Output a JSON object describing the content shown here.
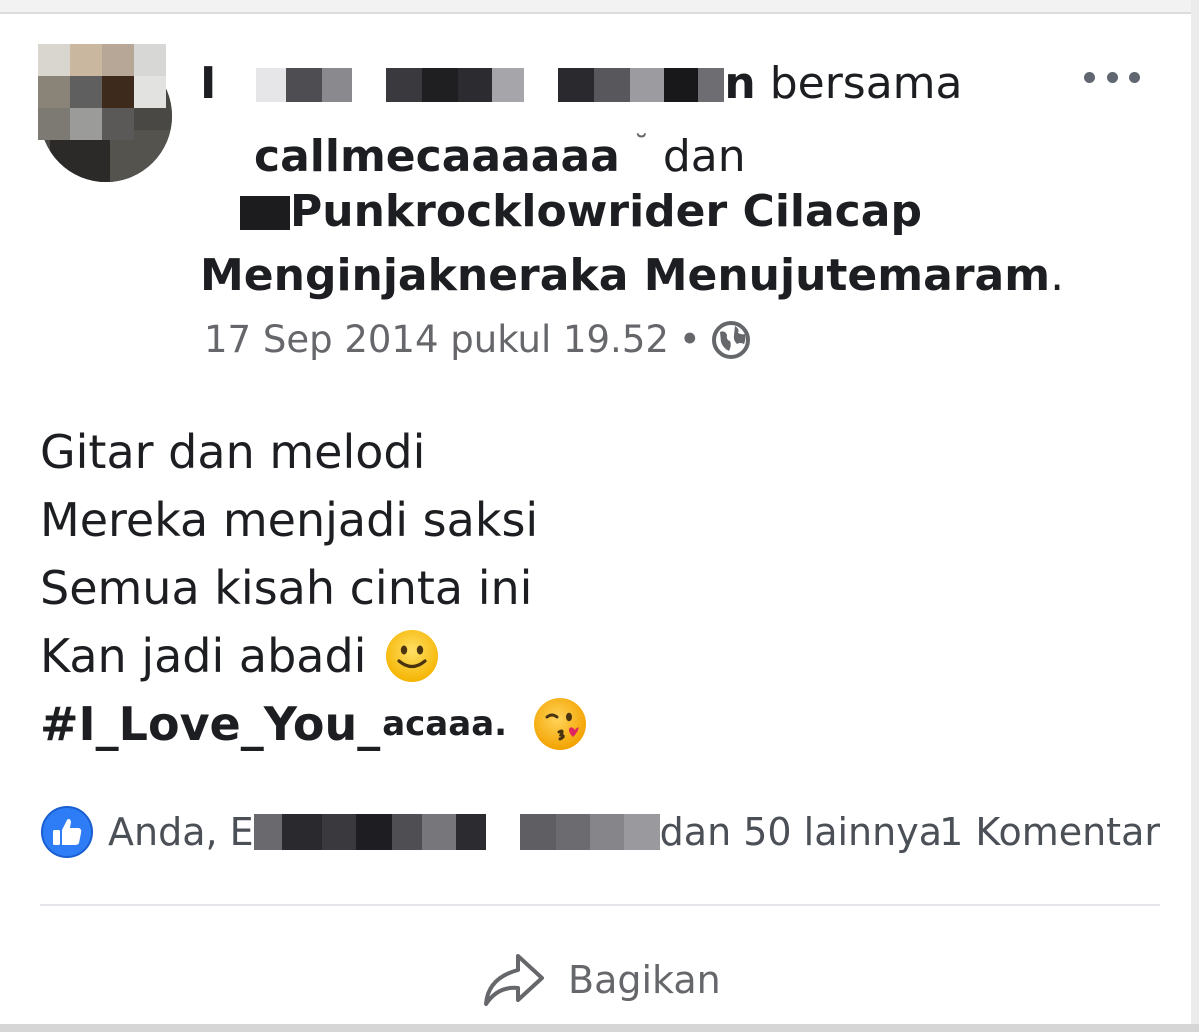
{
  "post": {
    "author_prefix": "I",
    "author_suffix": "n",
    "with_word": "bersama",
    "tagged_1": "callmecaaaaaa",
    "and_word": "dan",
    "tagged_2": "Punkrocklowrider Cilacap",
    "line_4": "Menginjakneraka Menujutemaram",
    "line_4_end": ".",
    "timestamp": "17 Sep 2014 pukul 19.52",
    "separator": "•",
    "privacy_icon": "globe-icon",
    "more_icon": "more-options-icon",
    "body_lines": [
      "Gitar dan melodi",
      "Mereka menjadi saksi",
      "Semua kisah cinta ini",
      "Kan jadi abadi"
    ],
    "hashtag": "#I_Love_You_",
    "hashtag_end": "acaaa.",
    "emoji_1": "slightly-smiling-face-emoji",
    "emoji_2": "face-blowing-kiss-emoji"
  },
  "reactions": {
    "icon": "like-icon",
    "prefix": "Anda, E",
    "suffix": "dan 50 lainnya",
    "comments": "1 Komentar"
  },
  "actions": {
    "share_label": "Bagikan",
    "share_icon": "share-icon"
  },
  "colors": {
    "text": "#1c1e21",
    "meta_text": "#65676b",
    "like_blue": "#1877f2"
  }
}
